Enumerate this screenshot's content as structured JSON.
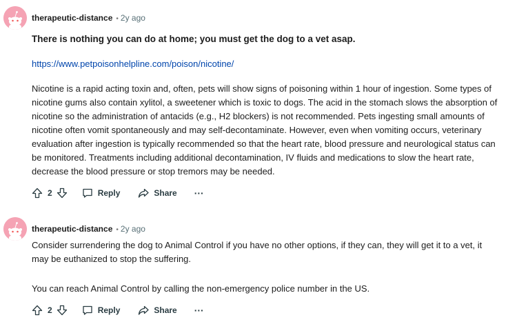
{
  "comments": [
    {
      "author": "therapeutic-distance",
      "separator": "•",
      "time": "2y ago",
      "bold_line": "There is nothing you can do at home; you must get the dog to a vet asap.",
      "link": "https://www.petpoisonhelpline.com/poison/nicotine/",
      "paragraph": "Nicotine is a rapid acting toxin and, often, pets will show signs of poisoning within 1 hour of ingestion. Some types of nicotine gums also contain xylitol, a sweetener which is toxic to dogs. The acid in the stomach slows the absorption of nicotine so the administration of antacids (e.g., H2 blockers) is not recommended. Pets ingesting small amounts of nicotine often vomit spontaneously and may self-decontaminate. However, even when vomiting occurs, veterinary evaluation after ingestion is typically recommended so that the heart rate, blood pressure and neurological status can be monitored. Treatments including additional decontamination, IV fluids and medications to slow the heart rate, decrease the blood pressure or stop tremors may be needed.",
      "votes": "2",
      "reply_label": "Reply",
      "share_label": "Share",
      "more_label": "···"
    },
    {
      "author": "therapeutic-distance",
      "separator": "•",
      "time": "2y ago",
      "paragraph1": "Consider surrendering the dog to Animal Control if you have no other options, if they can, they will get it to a vet, it may be euthanized to stop the suffering.",
      "paragraph2": "You can reach Animal Control by calling the non-emergency police number in the US.",
      "votes": "2",
      "reply_label": "Reply",
      "share_label": "Share",
      "more_label": "···"
    }
  ],
  "colors": {
    "avatar_bg": "#f5a3b4",
    "link": "#0045ac",
    "meta_time": "#576f76",
    "text": "#1c1c1c"
  },
  "icons": [
    "snoo-avatar-icon",
    "upvote-arrow-icon",
    "downvote-arrow-icon",
    "comment-bubble-icon",
    "share-arrow-icon",
    "more-options-icon"
  ]
}
